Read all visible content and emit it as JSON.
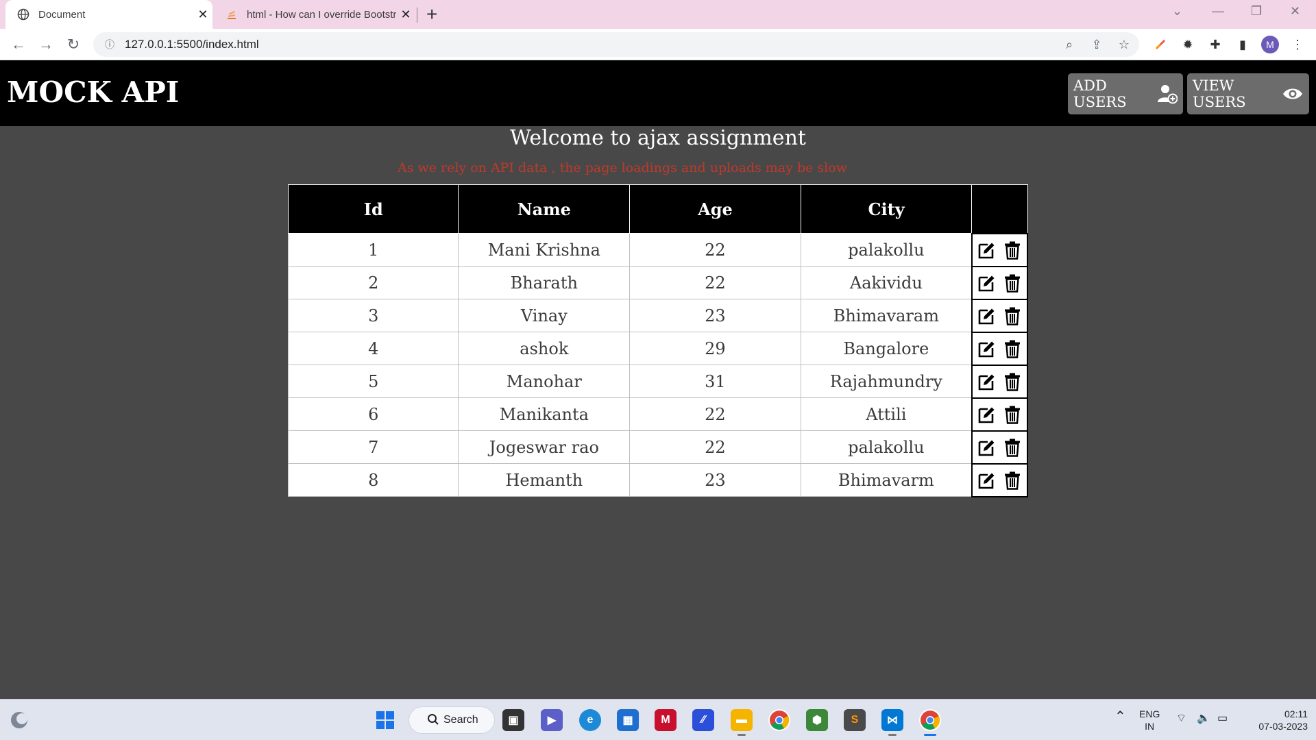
{
  "browser": {
    "tabs": [
      {
        "title": "Document",
        "active": true
      },
      {
        "title": "html - How can I override Bootstr",
        "active": false
      }
    ],
    "url": "127.0.0.1:5500/index.html",
    "profile_initial": "M"
  },
  "app": {
    "brand": "MOCK API",
    "add_users_label": "ADD USERS",
    "view_users_label": "VIEW USERS",
    "welcome": "Welcome to ajax assignment",
    "notice": "As we rely on API data , the page loadings and uploads may be slow",
    "table": {
      "headers": [
        "Id",
        "Name",
        "Age",
        "City",
        ""
      ],
      "rows": [
        {
          "id": "1",
          "name": "Mani Krishna",
          "age": "22",
          "city": "palakollu"
        },
        {
          "id": "2",
          "name": "Bharath",
          "age": "22",
          "city": "Aakividu"
        },
        {
          "id": "3",
          "name": "Vinay",
          "age": "23",
          "city": "Bhimavaram"
        },
        {
          "id": "4",
          "name": "ashok",
          "age": "29",
          "city": "Bangalore"
        },
        {
          "id": "5",
          "name": "Manohar",
          "age": "31",
          "city": "Rajahmundry"
        },
        {
          "id": "6",
          "name": "Manikanta",
          "age": "22",
          "city": "Attili"
        },
        {
          "id": "7",
          "name": "Jogeswar rao",
          "age": "22",
          "city": "palakollu"
        },
        {
          "id": "8",
          "name": "Hemanth",
          "age": "23",
          "city": "Bhimavarm"
        }
      ]
    }
  },
  "taskbar": {
    "search_label": "Search",
    "language": "ENG",
    "region": "IN",
    "time": "02:11",
    "date": "07-03-2023"
  },
  "colors": {
    "page_bg": "#484848",
    "navbar_bg": "#000000",
    "button_bg": "#6c6c6c",
    "notice": "#c0392b",
    "tabstrip": "#f2d5e6"
  }
}
